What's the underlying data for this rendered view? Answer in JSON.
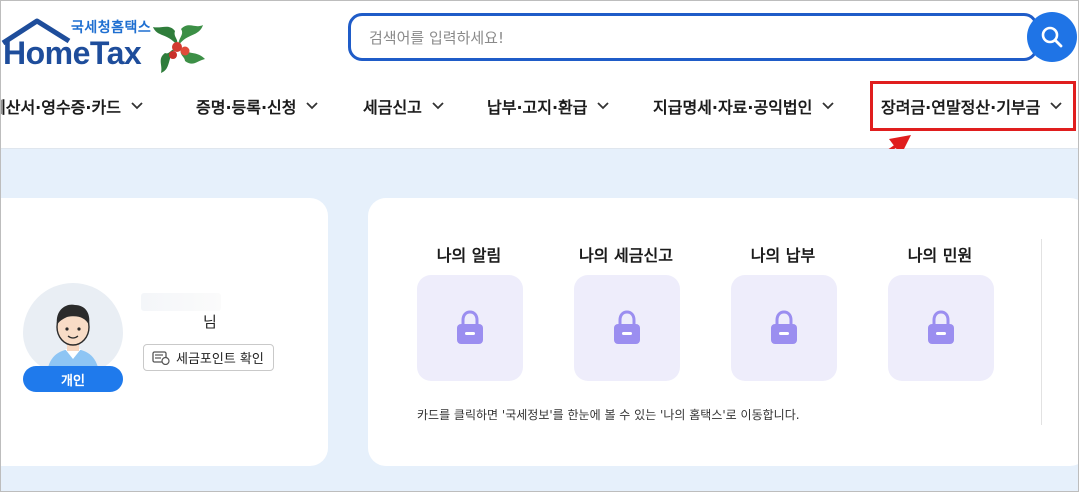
{
  "header": {
    "logo_kor": "국세청홈택스",
    "logo_main": "HomeTax",
    "search": {
      "placeholder": "검색어를 입력하세요!",
      "value": ""
    }
  },
  "nav": {
    "items": [
      {
        "label": "계산서·영수증·카드"
      },
      {
        "label": "증명·등록·신청"
      },
      {
        "label": "세금신고"
      },
      {
        "label": "납부·고지·환급"
      },
      {
        "label": "지급명세·자료·공익법인"
      },
      {
        "label": "장려금·연말정산·기부금"
      }
    ]
  },
  "profile": {
    "suffix": "님",
    "tax_point_label": "세금포인트 확인",
    "badge": "개인"
  },
  "services": {
    "items": [
      {
        "title": "나의 알림"
      },
      {
        "title": "나의 세금신고"
      },
      {
        "title": "나의 납부"
      },
      {
        "title": "나의 민원"
      }
    ],
    "hint": "카드를 클릭하면 '국세정보'를 한눈에 볼 수 있는 '나의 홈택스'로 이동합니다."
  },
  "colors": {
    "brand_blue": "#1f5cc8",
    "button_blue": "#1f74e6",
    "highlight_red": "#e01e1e",
    "tile_bg": "#eeedfb",
    "lock_purple": "#9b8ef0"
  }
}
